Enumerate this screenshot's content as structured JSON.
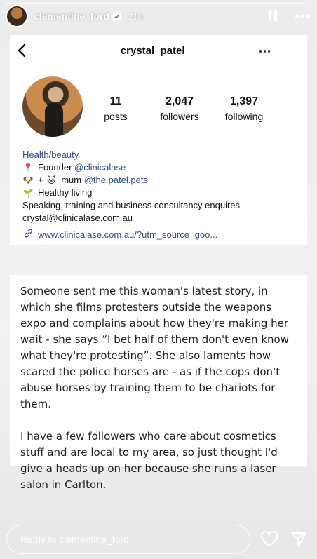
{
  "story": {
    "username": "clementine_ford",
    "time_ago": "21h",
    "progress": 0.97,
    "reply_placeholder": "Reply to clementine_ford..."
  },
  "screenshot_profile": {
    "handle": "crystal_patel__",
    "stats": [
      {
        "value": "11",
        "label": "posts"
      },
      {
        "value": "2,047",
        "label": "followers"
      },
      {
        "value": "1,397",
        "label": "following"
      }
    ],
    "category": "Health/beauty",
    "bio": {
      "founder_prefix": "Founder",
      "founder_link": "@clinicalase",
      "pets_middle": "mum",
      "pets_link": "@the.patel.pets",
      "healthy": "Healthy living",
      "speaking": "Speaking, training and business consultancy enquires",
      "email": "crystal@clinicalase.com.au",
      "url": "www.clinicalase.com.au/?utm_source=goo..."
    }
  },
  "note": {
    "paragraph_1": "Someone sent me this woman's latest story, in which she films protesters outside the weapons expo and complains about how they're making her wait - she says “I bet half of them don't even know what they're protesting”. She also laments how scared the police horses are - as if the cops don't abuse horses by training them to be chariots for them.",
    "paragraph_2": "I have a few followers who care about cosmetics stuff and are local to my area, so just thought I'd give a heads up on her because she runs a laser salon in Carlton."
  },
  "icons": {
    "pause": "pause-icon",
    "more": "more-icon",
    "verified": "verified-badge-icon",
    "back": "back-arrow-icon",
    "pin": "pin-icon",
    "dog": "dog-icon",
    "cat": "cat-icon",
    "seedling": "seedling-icon",
    "link": "link-icon",
    "heart": "heart-icon",
    "send": "send-icon"
  }
}
